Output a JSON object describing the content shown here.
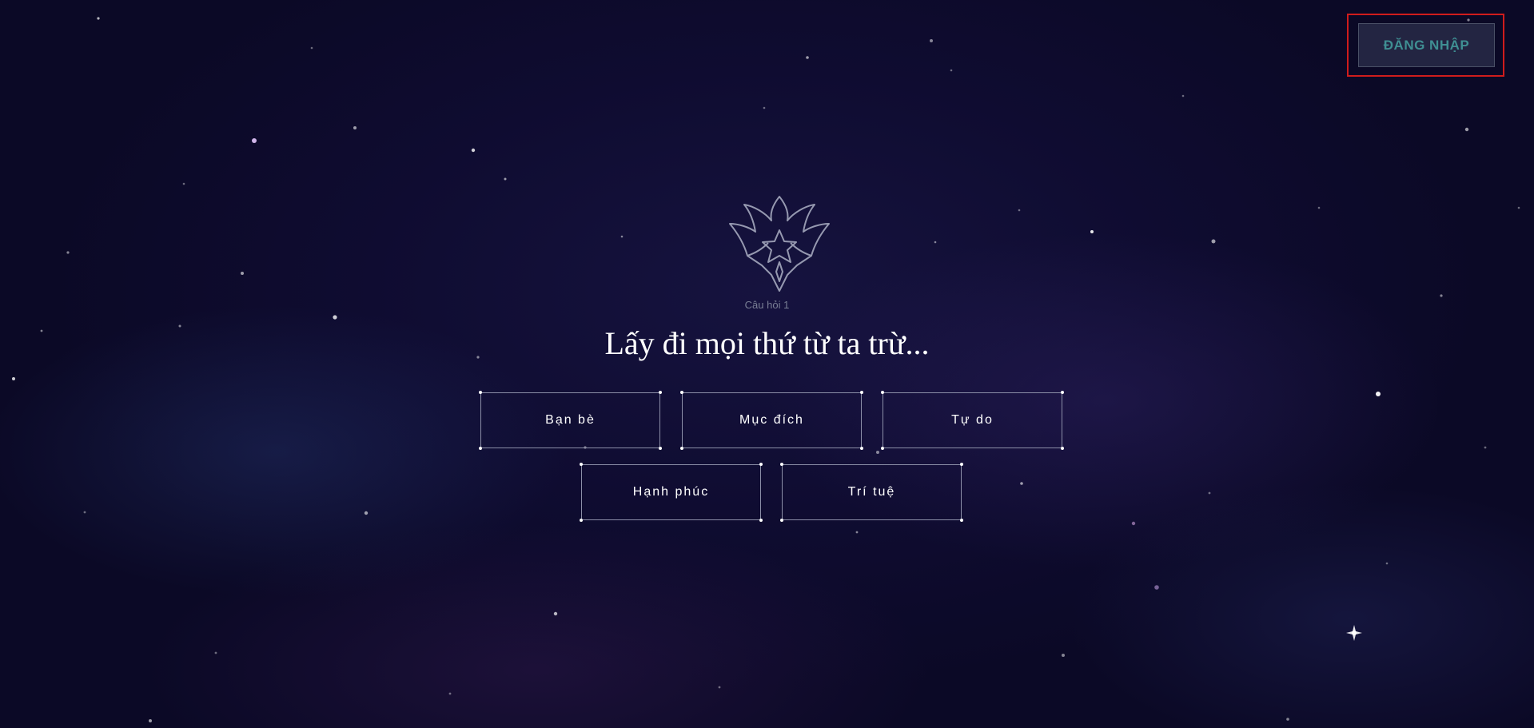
{
  "header": {
    "login_label": "ĐĂNG NHẬP"
  },
  "quiz": {
    "emblem_icon": "star-wings-emblem-icon",
    "question_number": "Câu hỏi 1",
    "question": "Lấy đi mọi thứ từ ta trừ...",
    "answers": [
      "Bạn bè",
      "Mục đích",
      "Tự do",
      "Hạnh phúc",
      "Trí tuệ"
    ]
  },
  "colors": {
    "background": "#0f0c31",
    "login_text": "#3f8f93",
    "highlight_frame": "#d01c1c",
    "answer_border": "#8c8fa8"
  }
}
